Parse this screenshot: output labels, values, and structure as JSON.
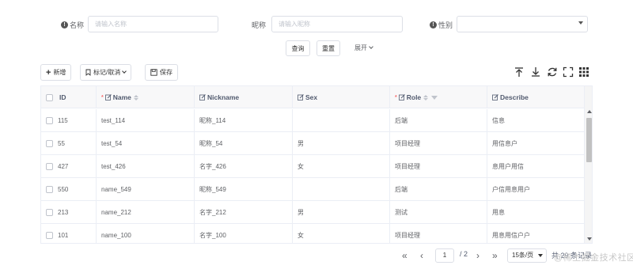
{
  "search_form": {
    "name_label": "名称",
    "name_placeholder": "请输入名称",
    "nickname_label": "昵称",
    "nickname_placeholder": "请输入昵称",
    "gender_label": "性别",
    "gender_value": "",
    "query_button": "查询",
    "reset_button": "重置",
    "expand_label": "展开"
  },
  "toolbar": {
    "add_label": "新增",
    "mark_label": "标记/取消",
    "save_label": "保存",
    "icons": [
      "export-top-icon",
      "download-icon",
      "refresh-icon",
      "fullscreen-icon",
      "column-settings-icon"
    ]
  },
  "table": {
    "columns": [
      {
        "key": "id",
        "label": "ID"
      },
      {
        "key": "name",
        "label": "Name"
      },
      {
        "key": "nickname",
        "label": "Nickname"
      },
      {
        "key": "sex",
        "label": "Sex"
      },
      {
        "key": "role",
        "label": "Role"
      },
      {
        "key": "describe",
        "label": "Describe"
      }
    ],
    "rows": [
      {
        "id": "115",
        "name": "test_114",
        "nickname": "昵称_114",
        "sex": "",
        "role": "后端",
        "describe": "信息"
      },
      {
        "id": "55",
        "name": "test_54",
        "nickname": "昵称_54",
        "sex": "男",
        "role": "项目经理",
        "describe": "用信息户"
      },
      {
        "id": "427",
        "name": "test_426",
        "nickname": "名字_426",
        "sex": "女",
        "role": "项目经理",
        "describe": "息用户用信"
      },
      {
        "id": "550",
        "name": "name_549",
        "nickname": "昵称_549",
        "sex": "",
        "role": "后端",
        "describe": "户信用息用户"
      },
      {
        "id": "213",
        "name": "name_212",
        "nickname": "名字_212",
        "sex": "男",
        "role": "测试",
        "describe": "用息"
      },
      {
        "id": "101",
        "name": "name_100",
        "nickname": "名字_100",
        "sex": "女",
        "role": "项目经理",
        "describe": "用息用信户户"
      }
    ]
  },
  "pager": {
    "current_page": "1",
    "total_pages": "/ 2",
    "page_size": "15条/页",
    "total_text": "共 29 条记录"
  },
  "watermark": "@稀土掘金技术社区"
}
